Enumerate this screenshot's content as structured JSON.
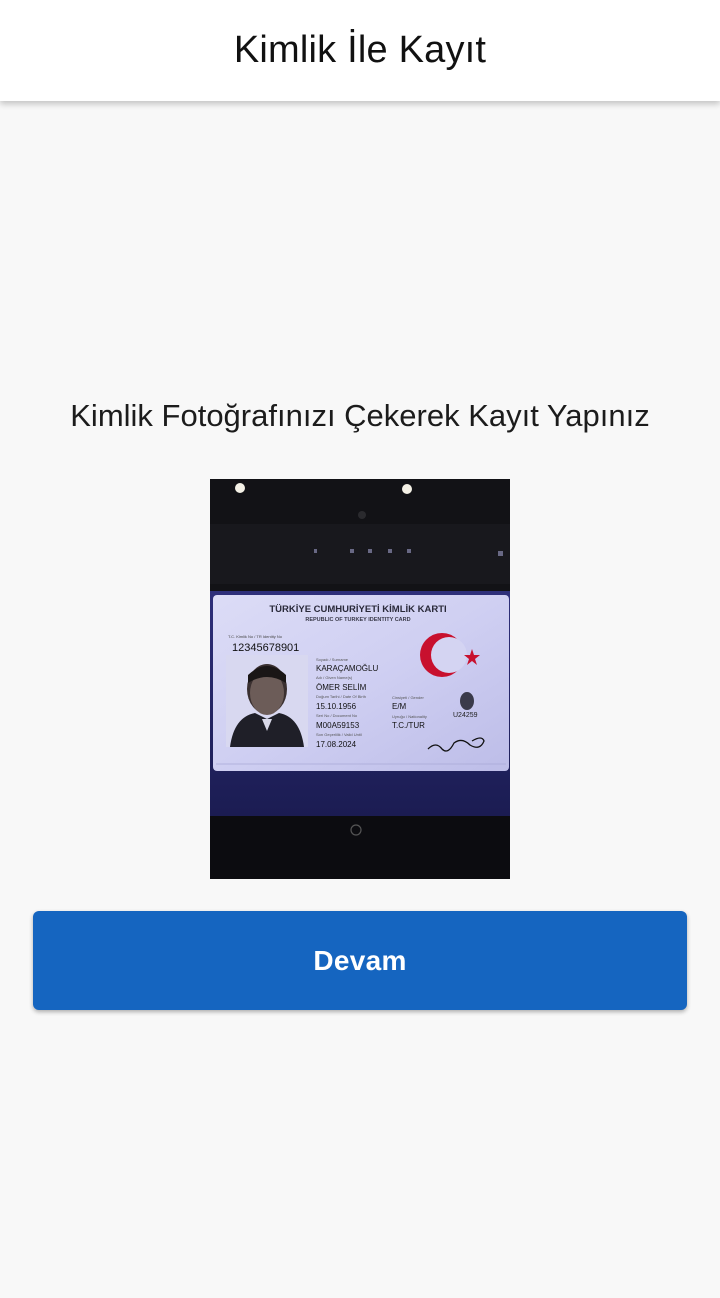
{
  "appbar": {
    "title": "Kimlik İle Kayıt"
  },
  "main": {
    "prompt": "Kimlik Fotoğrafınızı Çekerek Kayıt Yapınız",
    "continue_label": "Devam"
  },
  "id_card": {
    "title_tr": "TÜRKİYE CUMHURİYETİ KİMLİK KARTI",
    "title_en": "REPUBLIC OF TURKEY IDENTITY CARD",
    "tc_label": "T.C. Kimlik No / TR Identity No",
    "tc_no": "12345678901",
    "surname_label": "Soyadı / Surname",
    "surname": "KARAÇAMOĞLU",
    "name_label": "Adı / Given Name(s)",
    "name": "ÖMER SELİM",
    "dob_label": "Doğum Tarihi / Date Of Birth",
    "dob": "15.10.1956",
    "gender_label": "Cinsiyeti / Gender",
    "gender": "E/M",
    "serial_label": "Seri No / Document No",
    "serial": "M00A59153",
    "nationality_label": "Uyruğu / Nationality",
    "nationality": "T.C./TUR",
    "valid_label": "Son Geçerlilik / Valid Until",
    "valid_until": "17.08.2024",
    "small_code": "U24259"
  },
  "colors": {
    "primary": "#1565c0",
    "appbar_bg": "#ffffff",
    "page_bg": "#f8f8f8",
    "flag_red": "#c8102e"
  }
}
